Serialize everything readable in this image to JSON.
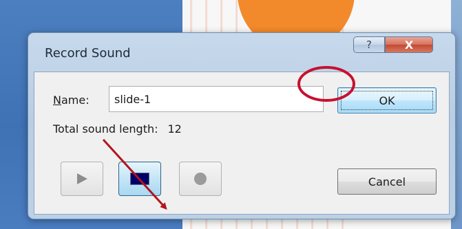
{
  "background": {
    "accent_colors": {
      "left_panel": "#4a7cc0",
      "shape": "#f2892a"
    }
  },
  "dialog": {
    "title": "Record Sound",
    "help_button_label": "?",
    "close_button_label": "X",
    "name_label_accel": "N",
    "name_label_rest": "ame:",
    "name_value": "slide-1",
    "length_label": "Total sound length:",
    "length_value": "12",
    "ok_label": "OK",
    "cancel_label": "Cancel",
    "media_buttons": {
      "play_icon": "play-icon",
      "stop_icon": "stop-icon",
      "record_icon": "record-icon"
    }
  },
  "annotations": {
    "circle_color": "#c8102e",
    "arrow_color": "#b3141b"
  }
}
